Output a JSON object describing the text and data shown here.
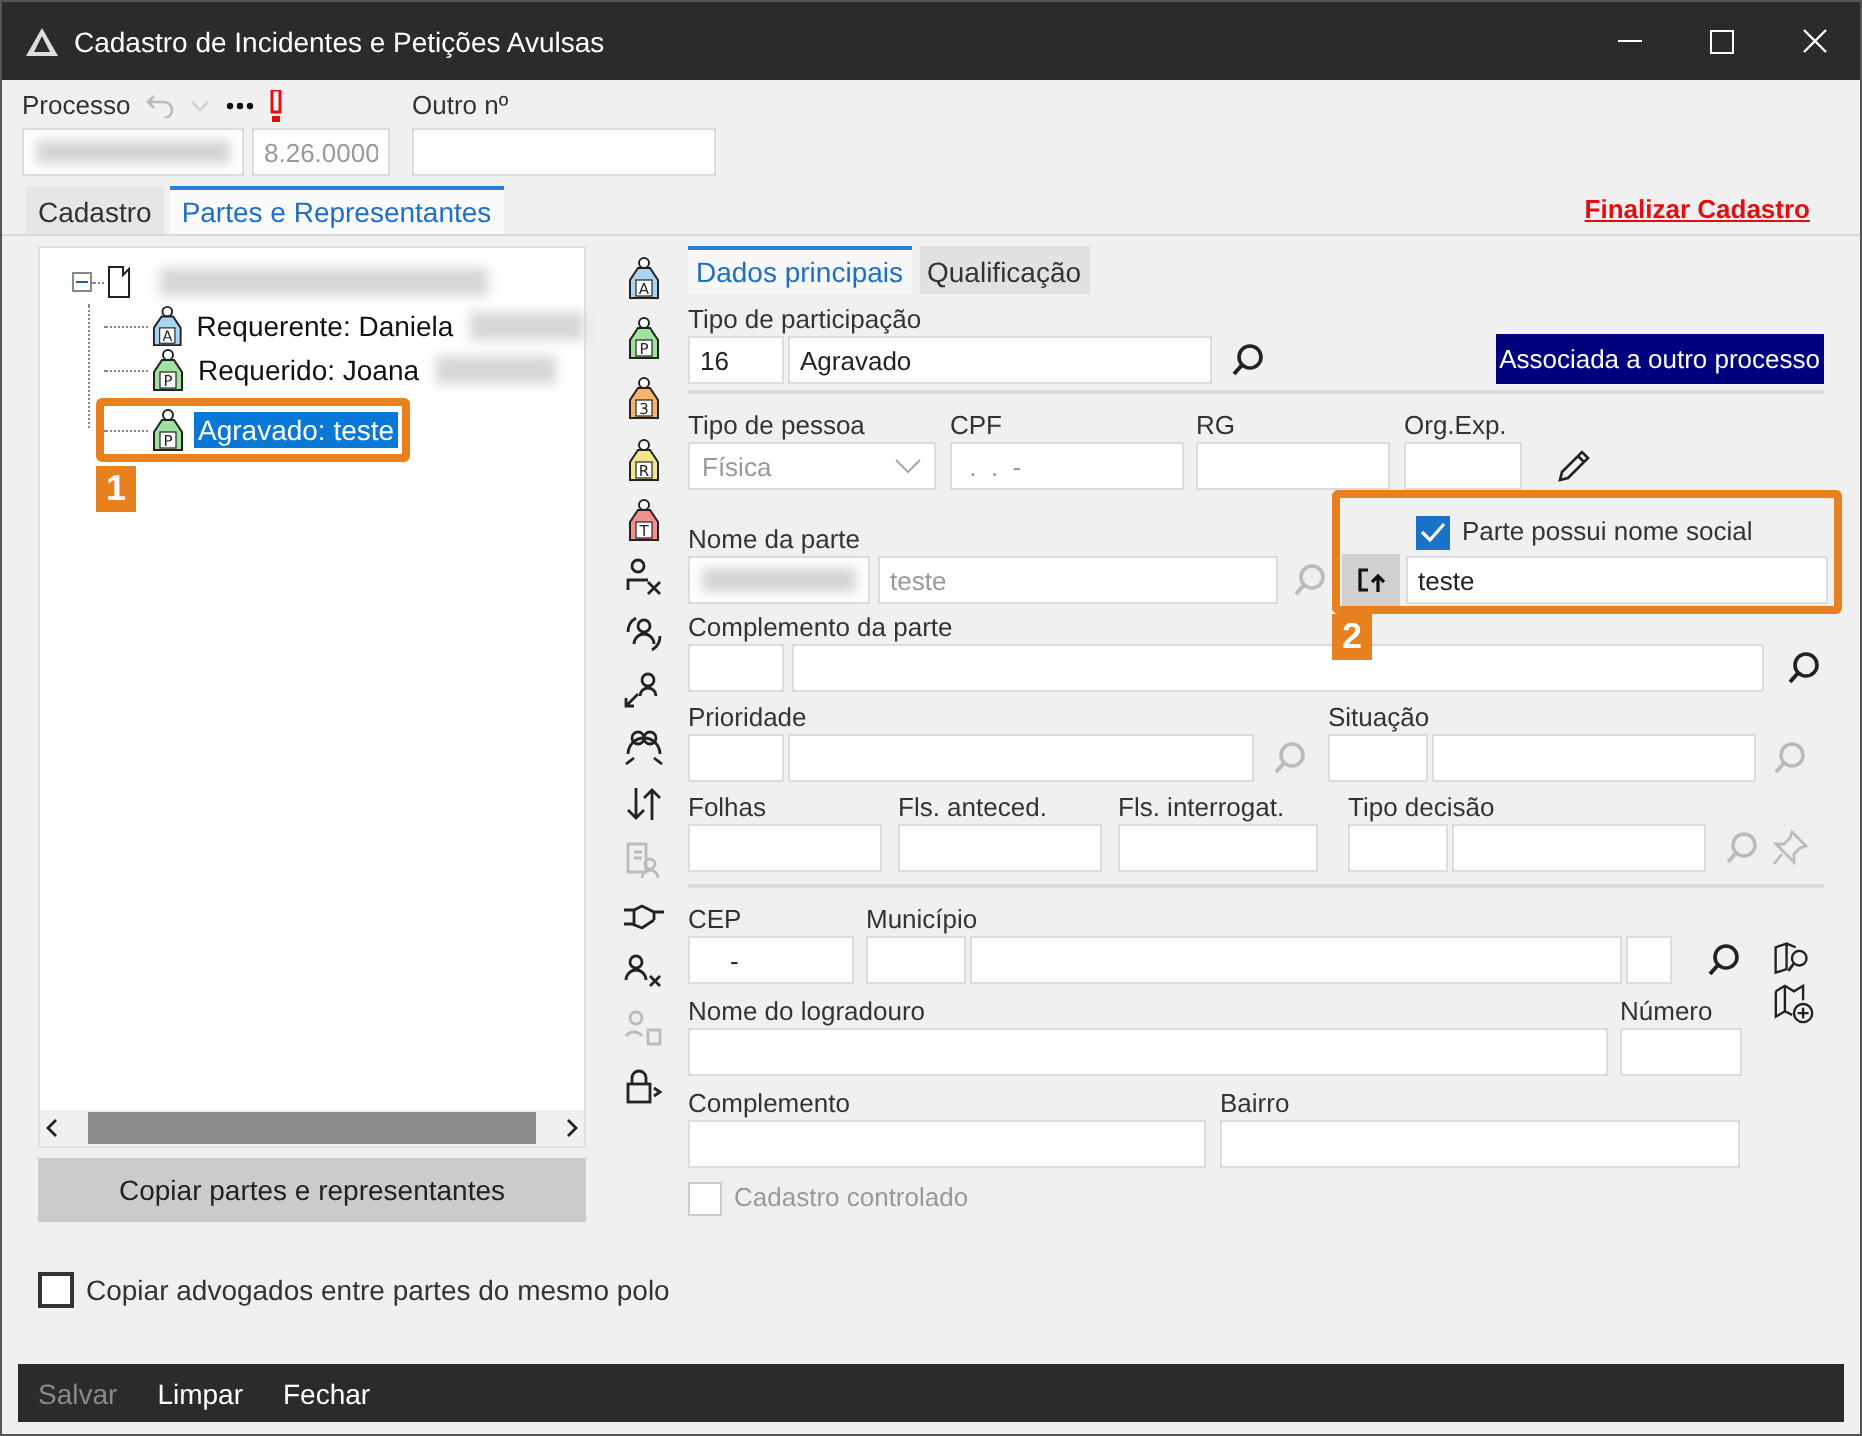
{
  "window": {
    "title": "Cadastro de Incidentes e Petições Avulsas"
  },
  "header": {
    "processo_label": "Processo",
    "processo_suffix": "8.26.0000",
    "outro_label": "Outro nº"
  },
  "tabs": [
    {
      "label": "Cadastro",
      "selected": false
    },
    {
      "label": "Partes e Representantes",
      "selected": true
    }
  ],
  "finalize_link": "Finalizar Cadastro",
  "tree": {
    "expanded": true,
    "children": [
      {
        "label": "Requerente: Daniela",
        "badge": "A",
        "color": "#a9d3f2",
        "selected": false
      },
      {
        "label": "Requerido: Joana",
        "badge": "P",
        "color": "#9fe39f",
        "selected": false
      },
      {
        "label": "Agravado: teste",
        "badge": "P",
        "color": "#9fe39f",
        "selected": true
      }
    ]
  },
  "copy_button": "Copiar partes e representantes",
  "party_types": [
    {
      "badge": "A",
      "color": "#a9d3f2"
    },
    {
      "badge": "P",
      "color": "#9fe39f"
    },
    {
      "badge": "3",
      "color": "#f5b56b"
    },
    {
      "badge": "R",
      "color": "#f2e48a"
    },
    {
      "badge": "T",
      "color": "#f29090"
    }
  ],
  "subtabs": [
    {
      "label": "Dados principais",
      "selected": true
    },
    {
      "label": "Qualificação",
      "selected": false
    }
  ],
  "form": {
    "tipo_participacao_label": "Tipo de participação",
    "tipo_participacao_code": "16",
    "tipo_participacao_value": "Agravado",
    "associated_badge": "Associada a outro processo",
    "tipo_pessoa_label": "Tipo de pessoa",
    "tipo_pessoa_value": "Física",
    "cpf_label": "CPF",
    "cpf_value": " .  .  -",
    "rg_label": "RG",
    "org_exp_label": "Org.Exp.",
    "nome_label": "Nome da parte",
    "nome_value": "teste",
    "nome_social_checkbox": {
      "label": "Parte possui nome social",
      "checked": true
    },
    "nome_social_value": "teste",
    "complemento_parte_label": "Complemento da parte",
    "prioridade_label": "Prioridade",
    "situacao_label": "Situação",
    "folhas_label": "Folhas",
    "fls_anteced_label": "Fls. anteced.",
    "fls_interrogat_label": "Fls. interrogat.",
    "tipo_decisao_label": "Tipo decisão",
    "cep_label": "CEP",
    "cep_value": "-",
    "municipio_label": "Município",
    "logradouro_label": "Nome do logradouro",
    "numero_label": "Número",
    "complemento_label": "Complemento",
    "bairro_label": "Bairro",
    "cadastro_controlado": {
      "label": "Cadastro controlado",
      "checked": false,
      "disabled": true
    }
  },
  "copy_lawyers": {
    "label": "Copiar advogados entre partes do mesmo polo",
    "checked": false
  },
  "annotations": [
    "1",
    "2"
  ],
  "footer": [
    {
      "label": "Salvar",
      "disabled": true
    },
    {
      "label": "Limpar",
      "disabled": false
    },
    {
      "label": "Fechar",
      "disabled": false
    }
  ]
}
